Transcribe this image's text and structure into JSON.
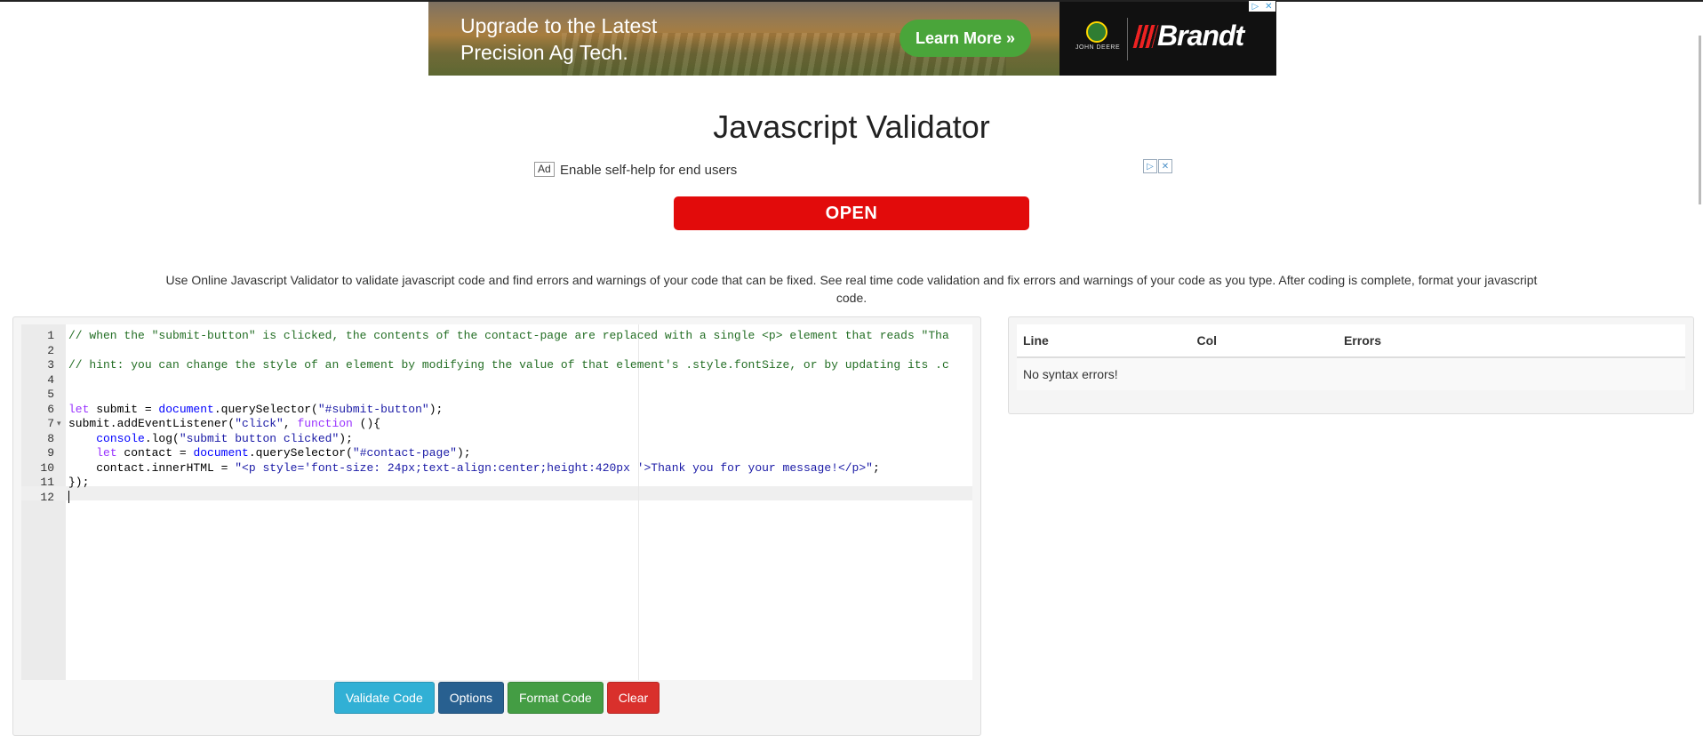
{
  "banner_ad": {
    "headline_line1": "Upgrade to the Latest",
    "headline_line2": "Precision Ag Tech.",
    "cta": "Learn More »",
    "partner_small": "JOHN DEERE",
    "brand": "Brandt"
  },
  "page": {
    "title": "Javascript Validator",
    "description": "Use Online Javascript Validator to validate javascript code and find errors and warnings of your code that can be fixed. See real time code validation and fix errors and warnings of your code as you type. After coding is complete, format your javascript code."
  },
  "text_ad": {
    "label": "Ad",
    "text": "Enable self-help for end users",
    "button": "OPEN"
  },
  "editor": {
    "lines": [
      {
        "n": "1",
        "text": "// when the \"submit-button\" is clicked, the contents of the contact-page are replaced with a single <p> element that reads \"Tha"
      },
      {
        "n": "2",
        "text": ""
      },
      {
        "n": "3",
        "text": "// hint: you can change the style of an element by modifying the value of that element's .style.fontSize, or by updating its .c"
      },
      {
        "n": "4",
        "text": ""
      },
      {
        "n": "5",
        "text": ""
      },
      {
        "n": "6",
        "text": "let submit = document.querySelector(\"#submit-button\");"
      },
      {
        "n": "7",
        "text": "submit.addEventListener(\"click\", function (){"
      },
      {
        "n": "8",
        "text": "    console.log(\"submit button clicked\");"
      },
      {
        "n": "9",
        "text": "    let contact = document.querySelector(\"#contact-page\");"
      },
      {
        "n": "10",
        "text": "    contact.innerHTML = \"<p style='font-size: 24px;text-align:center;height:420px '>Thank you for your message!</p>\";"
      },
      {
        "n": "11",
        "text": "});"
      },
      {
        "n": "12",
        "text": ""
      }
    ]
  },
  "buttons": {
    "validate": "Validate Code",
    "options": "Options",
    "format": "Format Code",
    "clear": "Clear"
  },
  "results": {
    "columns": [
      "Line",
      "Col",
      "Errors"
    ],
    "message": "No syntax errors!"
  },
  "colors": {
    "validate": "#31b0d5",
    "options": "#286090",
    "format": "#449d44",
    "clear": "#d9302c",
    "open": "#e20b0b"
  }
}
